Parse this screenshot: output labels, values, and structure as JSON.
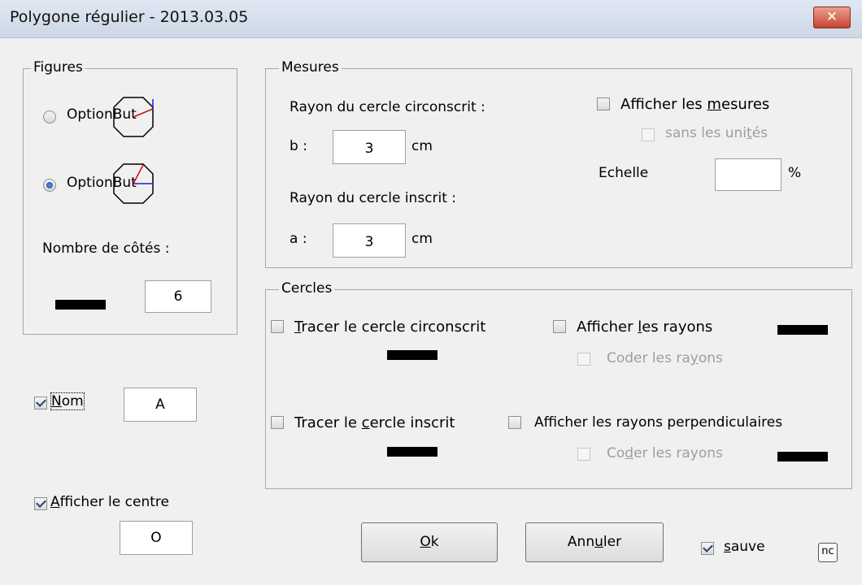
{
  "window": {
    "title": "Polygone régulier - 2013.03.05",
    "close_glyph": "✕"
  },
  "figures": {
    "legend": "Figures",
    "option1_label": "OptionBut",
    "option2_label": "OptionBut",
    "sides_label": "Nombre de côtés :",
    "sides_value": "6"
  },
  "mesures": {
    "legend": "Mesures",
    "circumscribed_label": "Rayon du cercle circonscrit :",
    "b_label": "b :",
    "b_value": "3",
    "b_unit": "cm",
    "inscribed_label": "Rayon du cercle inscrit :",
    "a_label": "a :",
    "a_value": "3",
    "a_unit": "cm",
    "show_measures_pre": "Afficher les ",
    "show_measures_key": "m",
    "show_measures_post": "esures",
    "no_units_pre": "sans les uni",
    "no_units_key": "t",
    "no_units_post": "és",
    "scale_label": "Echelle",
    "scale_value": "",
    "scale_unit": "%"
  },
  "cercles": {
    "legend": "Cercles",
    "trace_circ_key": "T",
    "trace_circ_post": "racer le cercle circonscrit",
    "show_radii_pre": "Afficher ",
    "show_radii_key": "l",
    "show_radii_post": "es rayons",
    "code_radii1_pre": "Coder les ra",
    "code_radii1_key": "y",
    "code_radii1_post": "ons",
    "trace_insc_pre": "Tracer le ",
    "trace_insc_key": "c",
    "trace_insc_post": "ercle inscrit",
    "show_perp": "Afficher les rayons perpendiculaires",
    "code_radii2_pre": "Co",
    "code_radii2_key": "d",
    "code_radii2_post": "er les rayons"
  },
  "nom": {
    "key": "N",
    "post": "om",
    "value": "A"
  },
  "centre": {
    "key": "A",
    "post": "fficher le centre",
    "value": "O"
  },
  "buttons": {
    "ok_key": "O",
    "ok_post": "k",
    "cancel_pre": "Ann",
    "cancel_key": "u",
    "cancel_post": "ler"
  },
  "sauve": {
    "key": "s",
    "post": "auve"
  },
  "nc_label": "nc"
}
